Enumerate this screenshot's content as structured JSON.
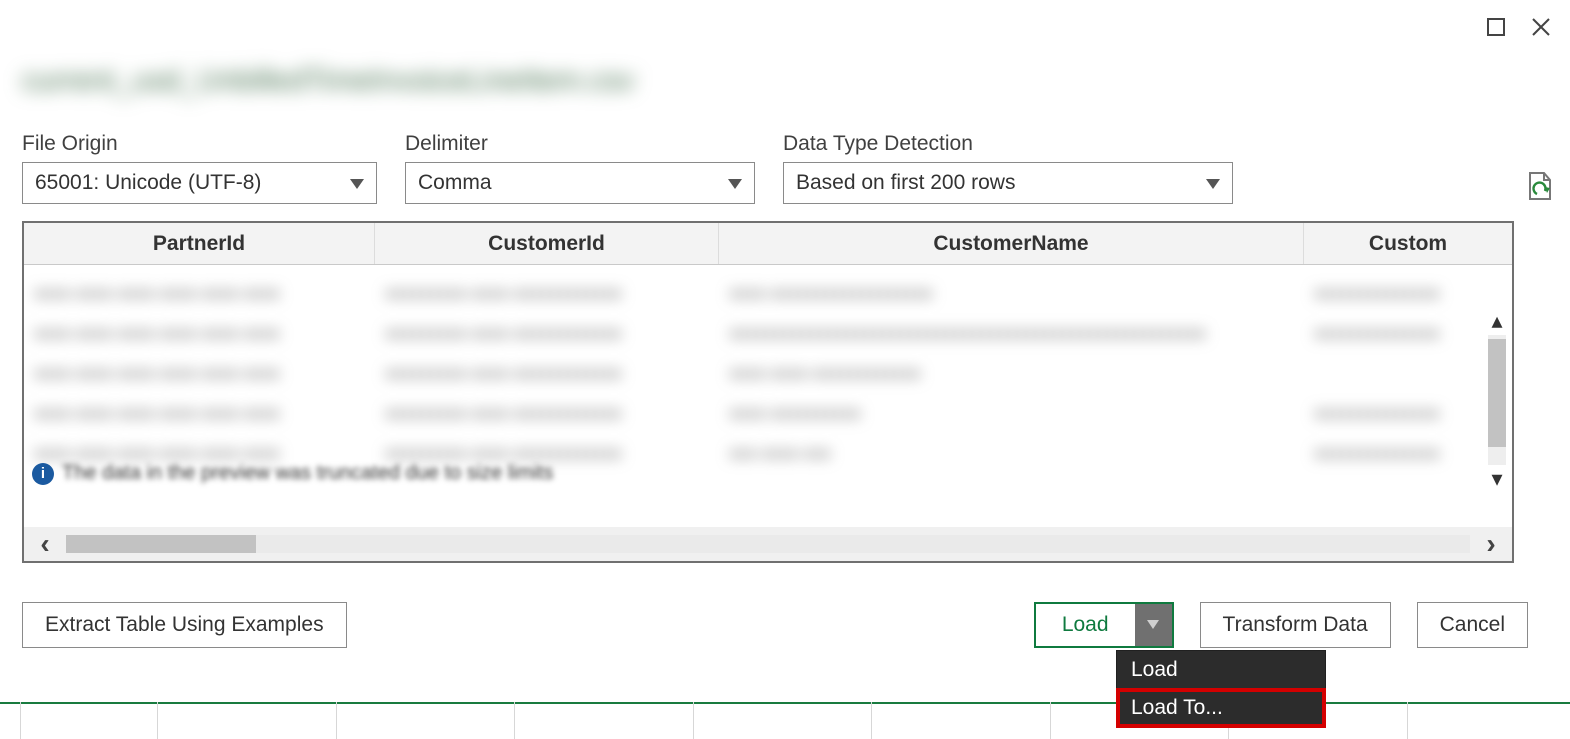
{
  "fileTitle": "current_usd_UnbilledTimeInvoiceLineItem.csv",
  "controls": {
    "fileOrigin": {
      "label": "File Origin",
      "value": "65001: Unicode (UTF-8)"
    },
    "delimiter": {
      "label": "Delimiter",
      "value": "Comma"
    },
    "dtd": {
      "label": "Data Type Detection",
      "value": "Based on first 200 rows"
    }
  },
  "columns": [
    "PartnerId",
    "CustomerId",
    "CustomerName",
    "Custom"
  ],
  "buttons": {
    "extract": "Extract Table Using Examples",
    "load": "Load",
    "transform": "Transform Data",
    "cancel": "Cancel"
  },
  "menu": {
    "load": "Load",
    "loadTo": "Load To..."
  },
  "infoText": "The data in the preview was truncated due to size limits"
}
